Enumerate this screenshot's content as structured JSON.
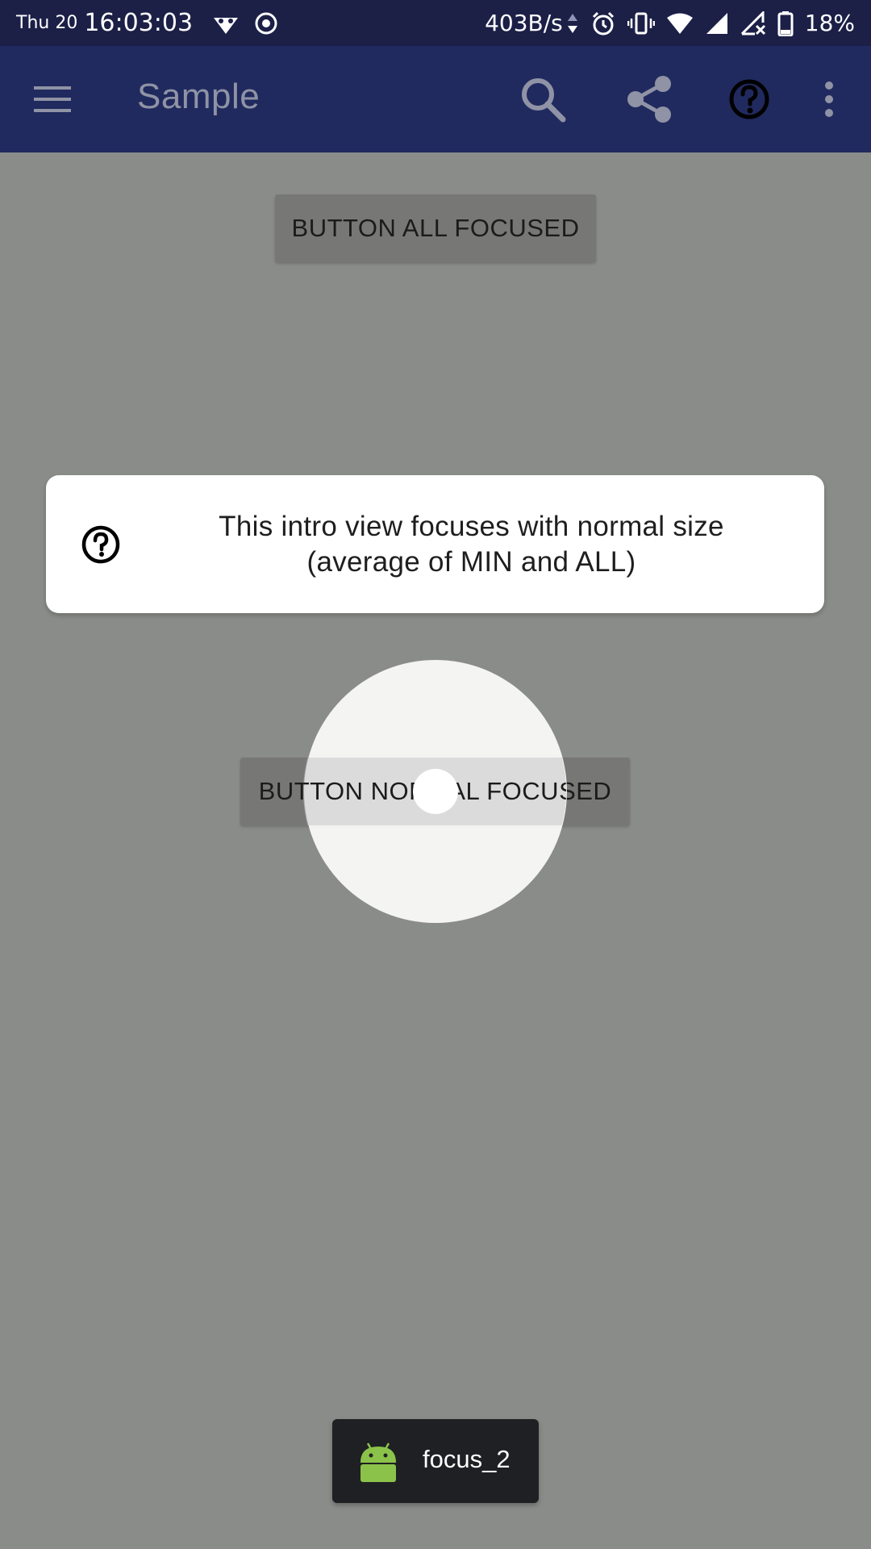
{
  "status_bar": {
    "day": "Thu 20",
    "time": "16:03:03",
    "net_speed": "403B/s",
    "battery_pct": "18%"
  },
  "app_bar": {
    "title": "Sample",
    "icons": [
      "menu-icon",
      "search-icon",
      "share-icon",
      "help-icon",
      "more-vert-icon"
    ]
  },
  "main": {
    "button_all_label": "BUTTON ALL FOCUSED",
    "button_normal_label": "BUTTON NORMAL FOCUSED"
  },
  "intro": {
    "text_line1": "This intro view focuses with normal size",
    "text_line2": "(average of MIN and ALL)",
    "icon": "help-outline-icon"
  },
  "toast": {
    "text": "focus_2",
    "icon": "android-icon"
  },
  "colors": {
    "status_bar_bg": "#1c2047",
    "app_bar_bg": "#202a5e",
    "scrim": "#8a8c89",
    "toast_bg": "#1f2023",
    "android_green": "#8bc34a"
  }
}
